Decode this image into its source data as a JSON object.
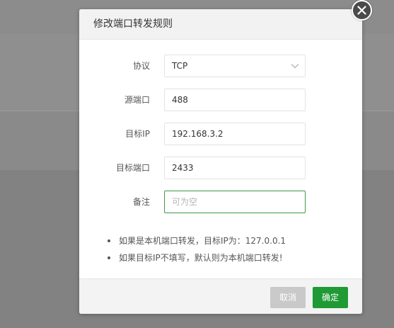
{
  "dialog": {
    "title": "修改端口转发规则",
    "fields": {
      "protocol": {
        "label": "协议",
        "value": "TCP"
      },
      "source_port": {
        "label": "源端口",
        "value": "488"
      },
      "target_ip": {
        "label": "目标IP",
        "value": "192.168.3.2"
      },
      "target_port": {
        "label": "目标端口",
        "value": "2433"
      },
      "remark": {
        "label": "备注",
        "value": "",
        "placeholder": "可为空"
      }
    },
    "notes": [
      "如果是本机端口转发，目标IP为：127.0.0.1",
      "如果目标IP不填写，默认则为本机端口转发!"
    ],
    "buttons": {
      "cancel": "取消",
      "confirm": "确定"
    }
  },
  "icons": {
    "close": "close-icon",
    "select_arrow": "chevron-down-icon"
  },
  "colors": {
    "confirm_button": "#1f9a34",
    "cancel_button": "#c9c9c9",
    "focused_border": "#3d9a48",
    "overlay": "#8a8a8a"
  }
}
